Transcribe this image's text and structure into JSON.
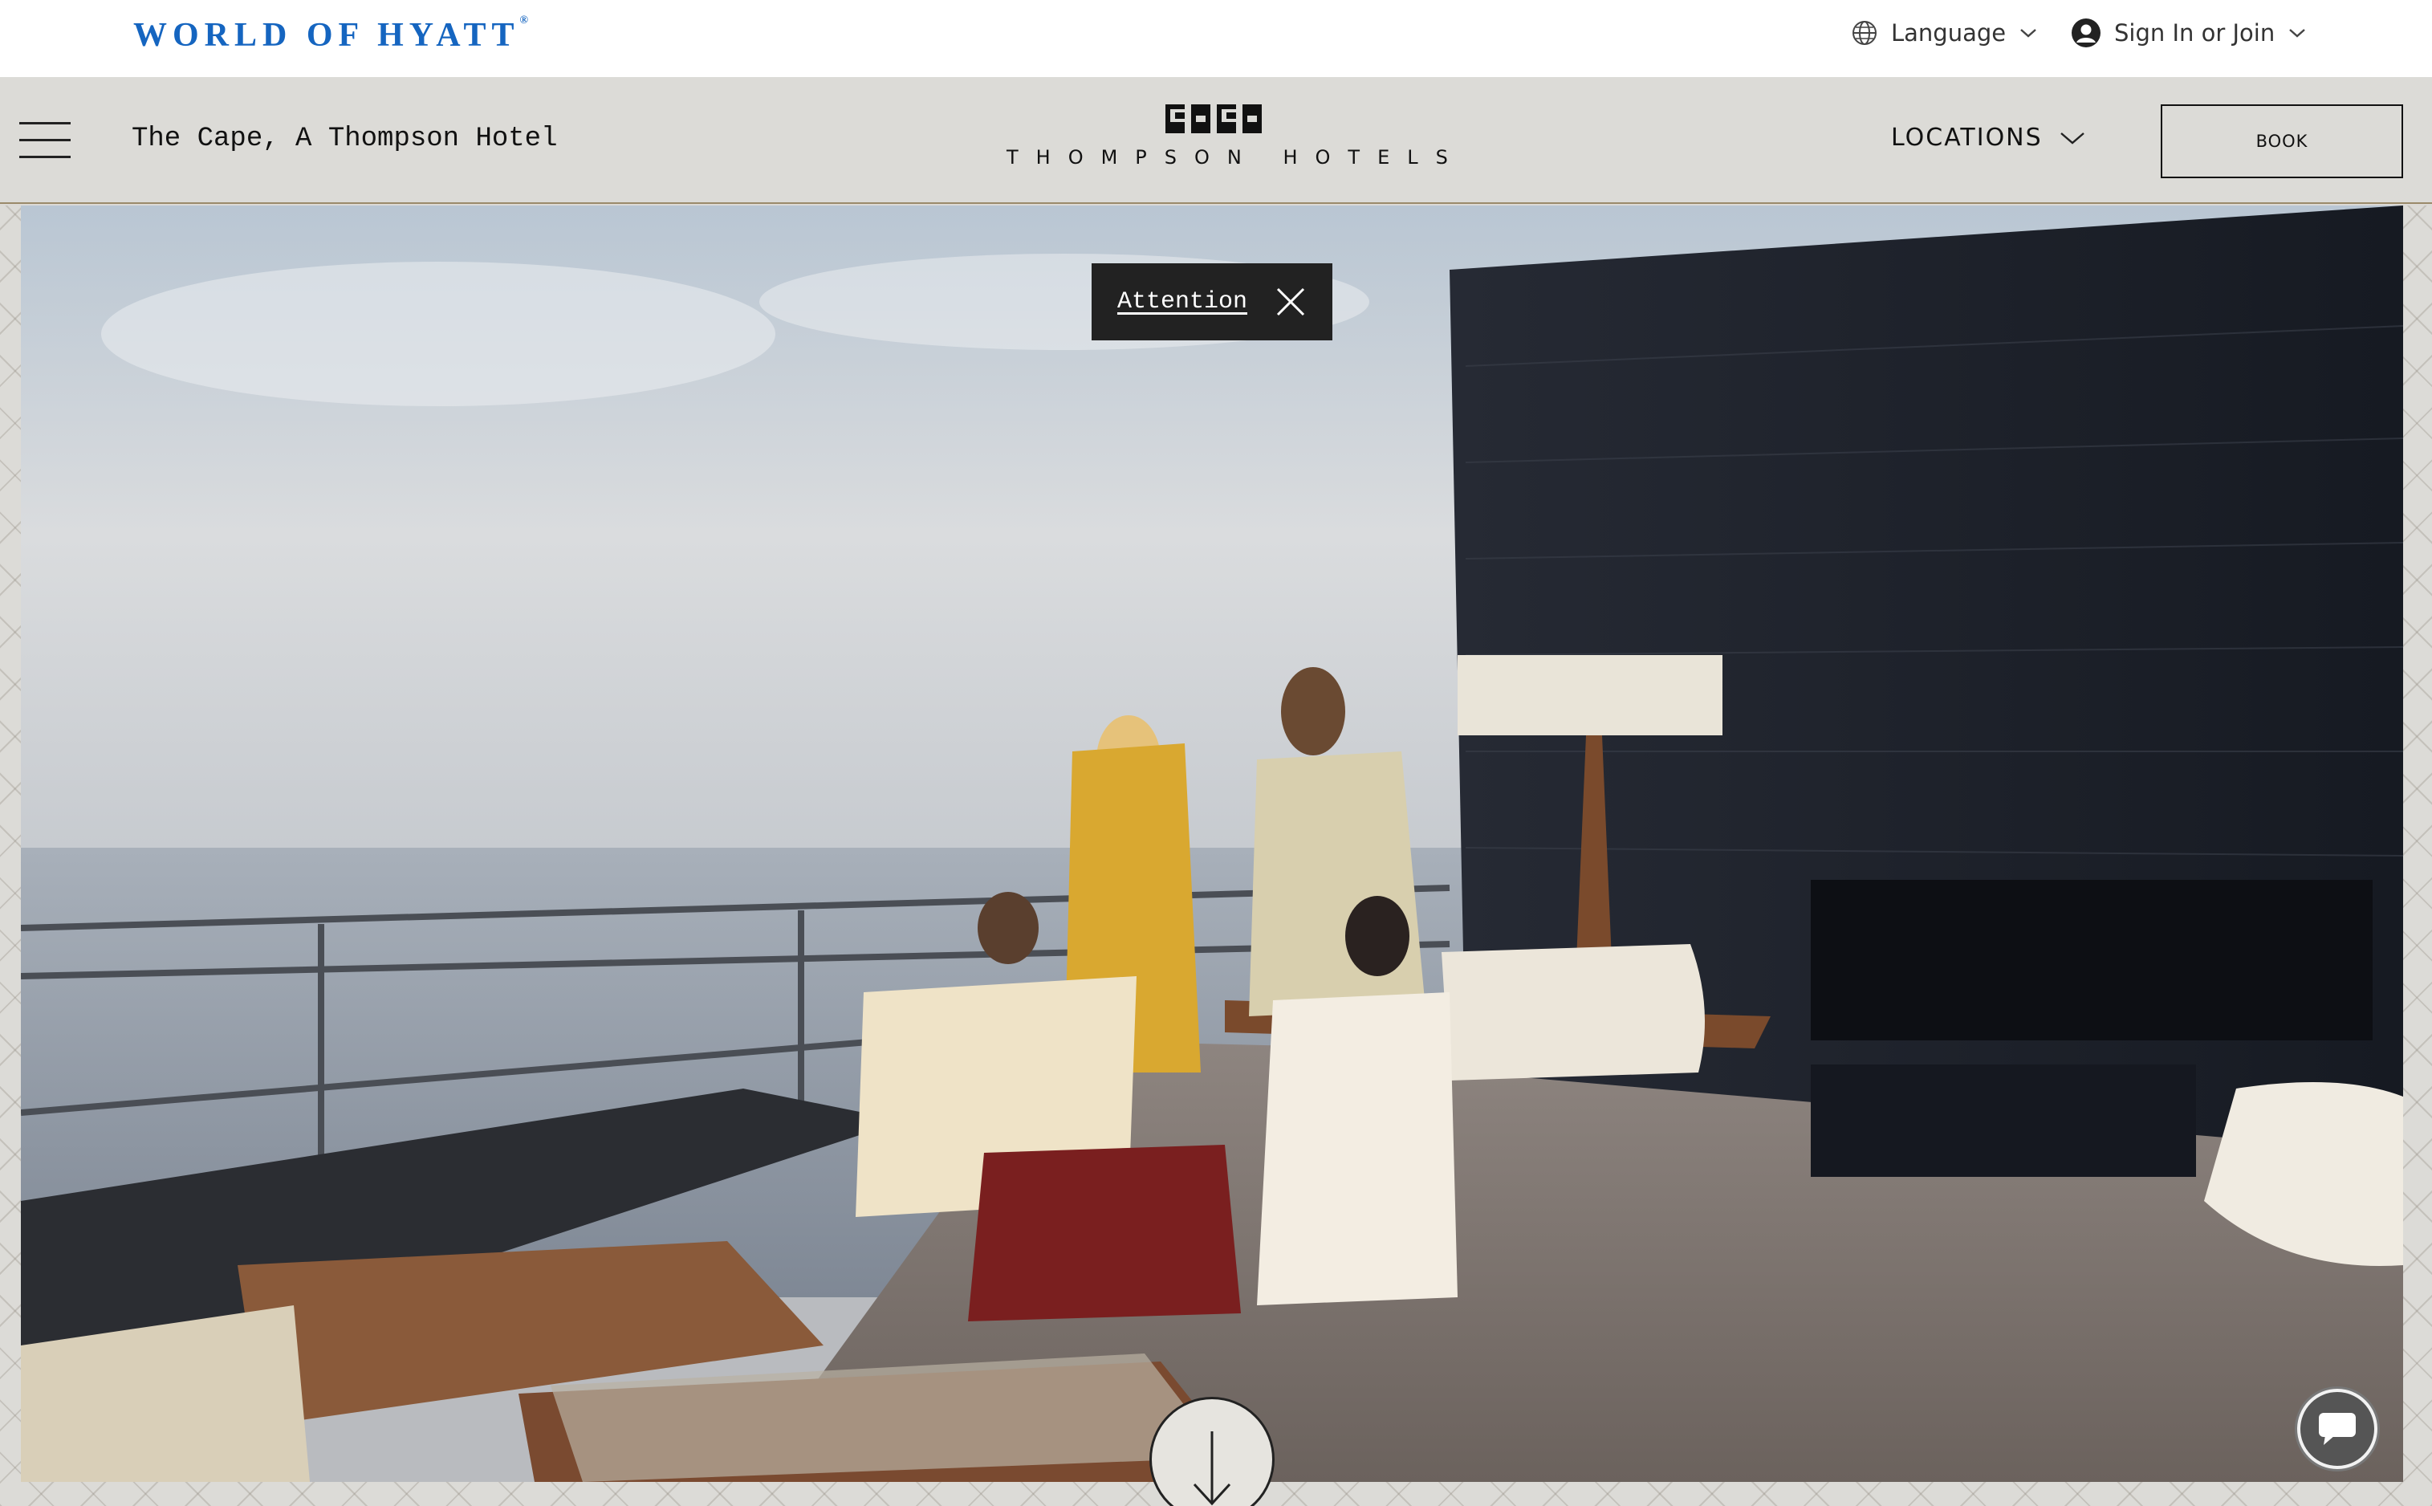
{
  "topbar": {
    "brand": "WORLD OF HYATT",
    "brand_mark": "®",
    "language_label": "Language",
    "language_icon": "globe-icon",
    "signin_label": "Sign In or Join",
    "signin_icon": "user-circle-icon",
    "dropdown_icon": "chevron-down-icon",
    "brand_color": "#1565c0"
  },
  "nav": {
    "menu_icon": "hamburger-menu-icon",
    "hotel_name": "The Cape, A Thompson Hotel",
    "brand_logo_text": "THOMPSON HOTELS",
    "locations_label": "LOCATIONS",
    "book_label": "BOOK"
  },
  "hero": {
    "image_description_icon": "hero-photo",
    "alert_label": "Attention",
    "alert_close_icon": "close-icon",
    "scroll_icon": "arrow-down-icon",
    "chat_icon": "chat-bubble-icon"
  }
}
